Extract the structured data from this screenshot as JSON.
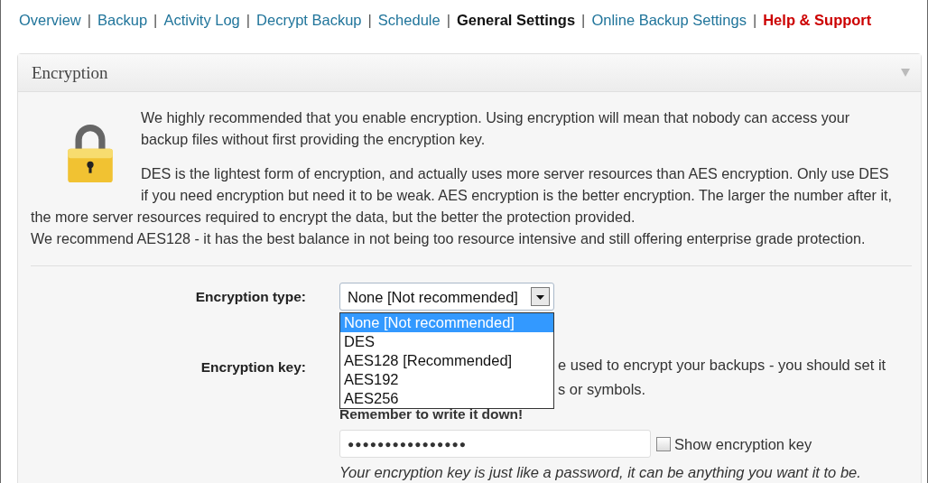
{
  "nav": {
    "separator": "|",
    "items": [
      {
        "label": "Overview",
        "selected": false,
        "kind": "link"
      },
      {
        "label": "Backup",
        "selected": false,
        "kind": "link"
      },
      {
        "label": "Activity Log",
        "selected": false,
        "kind": "link"
      },
      {
        "label": "Decrypt Backup",
        "selected": false,
        "kind": "link"
      },
      {
        "label": "Schedule",
        "selected": false,
        "kind": "link"
      },
      {
        "label": "General Settings",
        "selected": true,
        "kind": "link"
      },
      {
        "label": "Online Backup Settings",
        "selected": false,
        "kind": "link"
      },
      {
        "label": "Help & Support",
        "selected": false,
        "kind": "support"
      }
    ]
  },
  "panel": {
    "title": "Encryption",
    "intro": {
      "beside_icon": [
        [
          "We highly recommended that you enable encryption. Using encryption will mean that nobody can access your",
          "backup files without first providing the encryption key."
        ],
        [
          "DES is the lightest form of encryption, and actually uses more server resources than AES encryption. Only use DES",
          "if you need encryption but need it to be weak. AES encryption is the better encryption. The larger the number after it,"
        ]
      ],
      "full_width": [
        [
          "the more server resources required to encrypt the data, but the better the protection provided.",
          "We recommend AES128 - it has the best balance in not being too resource intensive and still offering enterprise grade protection."
        ]
      ]
    },
    "encryption_type": {
      "label": "Encryption type:",
      "value": "None [Not recommended]",
      "expanded": true,
      "options": [
        {
          "label": "None [Not recommended]",
          "selected": true
        },
        {
          "label": "DES",
          "selected": false
        },
        {
          "label": "AES128 [Recommended]",
          "selected": false
        },
        {
          "label": "AES192",
          "selected": false
        },
        {
          "label": "AES256",
          "selected": false
        }
      ]
    },
    "encryption_key": {
      "label": "Encryption key:",
      "description_lines": [
        "e used to encrypt your backups - you should set it",
        "s or symbols."
      ],
      "reminder": "Remember to write it down!",
      "value": "●●●●●●●●●●●●●●●●",
      "show_key": {
        "label": "Show encryption key",
        "checked": false
      },
      "hint": "Your encryption key is just like a password, it can be anything you want it to be."
    }
  }
}
